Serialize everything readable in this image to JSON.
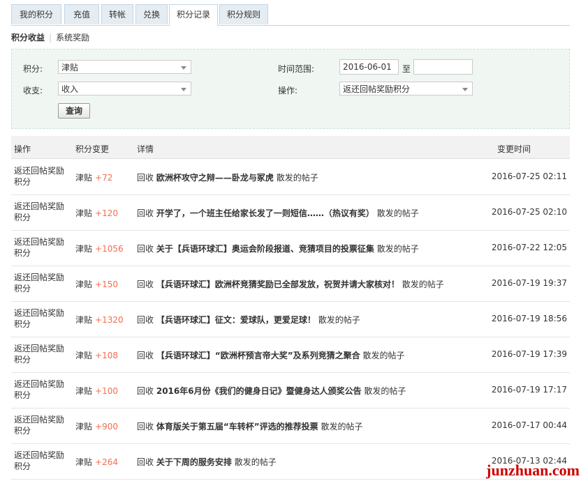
{
  "tabs": [
    "我的积分",
    "充值",
    "转帐",
    "兑换",
    "积分记录",
    "积分规则"
  ],
  "subnav": {
    "income": "积分收益",
    "system": "系统奖励"
  },
  "filter": {
    "credit_label": "积分:",
    "credit_value": "津贴",
    "range_label": "时间范围:",
    "date_from": "2016-06-01",
    "to_label": "至",
    "date_to": "",
    "inout_label": "收支:",
    "inout_value": "收入",
    "action_label": "操作:",
    "action_value": "返还回帖奖励积分",
    "query_button": "查询"
  },
  "table": {
    "headers": {
      "op": "操作",
      "change": "积分变更",
      "detail": "详情",
      "time": "变更时间"
    },
    "rows": [
      {
        "op": "返还回帖奖励积分",
        "credit": "津贴",
        "amount": "+72",
        "prefix": "回收",
        "title": "欧洲杯攻守之辩——卧龙与冢虎",
        "suffix": "散发的帖子",
        "time": "2016-07-25 02:11"
      },
      {
        "op": "返还回帖奖励积分",
        "credit": "津贴",
        "amount": "+120",
        "prefix": "回收",
        "title": "开学了，一个班主任给家长发了一则短信……（热议有奖）",
        "suffix": "散发的帖子",
        "time": "2016-07-25 02:10"
      },
      {
        "op": "返还回帖奖励积分",
        "credit": "津贴",
        "amount": "+1056",
        "prefix": "回收",
        "title": "关于【兵语环球汇】奥运会阶段报道、竞猜项目的投票征集",
        "suffix": "散发的帖子",
        "time": "2016-07-22 12:05"
      },
      {
        "op": "返还回帖奖励积分",
        "credit": "津贴",
        "amount": "+150",
        "prefix": "回收",
        "title": "【兵语环球汇】欧洲杯竞猜奖励已全部发放，祝贺并请大家核对！",
        "suffix": "散发的帖子",
        "time": "2016-07-19 19:37"
      },
      {
        "op": "返还回帖奖励积分",
        "credit": "津贴",
        "amount": "+1320",
        "prefix": "回收",
        "title": "【兵语环球汇】征文：爱球队，更爱足球！",
        "suffix": "散发的帖子",
        "time": "2016-07-19 18:56"
      },
      {
        "op": "返还回帖奖励积分",
        "credit": "津贴",
        "amount": "+108",
        "prefix": "回收",
        "title": "【兵语环球汇】“欧洲杯预言帝大奖”及系列竞猜之聚合",
        "suffix": "散发的帖子",
        "time": "2016-07-19 17:39"
      },
      {
        "op": "返还回帖奖励积分",
        "credit": "津贴",
        "amount": "+100",
        "prefix": "回收",
        "title": "2016年6月份《我们的健身日记》暨健身达人颁奖公告",
        "suffix": "散发的帖子",
        "time": "2016-07-19 17:17"
      },
      {
        "op": "返还回帖奖励积分",
        "credit": "津贴",
        "amount": "+900",
        "prefix": "回收",
        "title": "体育版关于第五届“车转杯”评选的推荐投票",
        "suffix": "散发的帖子",
        "time": "2016-07-17 00:44"
      },
      {
        "op": "返还回帖奖励积分",
        "credit": "津贴",
        "amount": "+264",
        "prefix": "回收",
        "title": "关于下周的服务安排",
        "suffix": "散发的帖子",
        "time": "2016-07-13 02:44"
      }
    ]
  },
  "watermark": "junzhuan.com"
}
